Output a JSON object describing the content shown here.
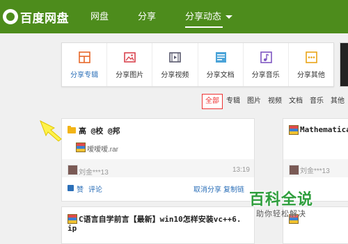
{
  "app": {
    "logo_text": "百度网盘"
  },
  "nav": {
    "items": [
      {
        "label": "网盘"
      },
      {
        "label": "分享"
      },
      {
        "label": "分享动态"
      }
    ]
  },
  "categories": [
    {
      "label": "分享专辑",
      "icon": "album-icon"
    },
    {
      "label": "分享图片",
      "icon": "image-icon"
    },
    {
      "label": "分享视频",
      "icon": "video-icon"
    },
    {
      "label": "分享文档",
      "icon": "document-icon"
    },
    {
      "label": "分享音乐",
      "icon": "music-icon"
    },
    {
      "label": "分享其他",
      "icon": "other-icon"
    }
  ],
  "filters": [
    "全部",
    "专辑",
    "图片",
    "视频",
    "文档",
    "音乐",
    "其他"
  ],
  "feed": {
    "card1": {
      "title": "高 @校 @邦",
      "file": "嗳嗳嗳.rar",
      "user": "刘金***13",
      "time": "13:19",
      "like": "赞",
      "comment": "评论",
      "cancel_share": "取消分享",
      "copy_link": "复制链"
    },
    "card2": {
      "title": "Mathematica_",
      "user": "刘金***13"
    },
    "card3": {
      "title_line1": "C语言自学前言【最新】win10怎样安装vc++6.",
      "title_line2": "ip"
    }
  },
  "watermark": {
    "title": "百科全说",
    "subtitle": "助你轻松解决"
  },
  "colors": {
    "nav_bg": "#4d8c1c",
    "link": "#2b6fb8",
    "active_filter": "#e33333",
    "watermark": "#2e9e3c"
  }
}
